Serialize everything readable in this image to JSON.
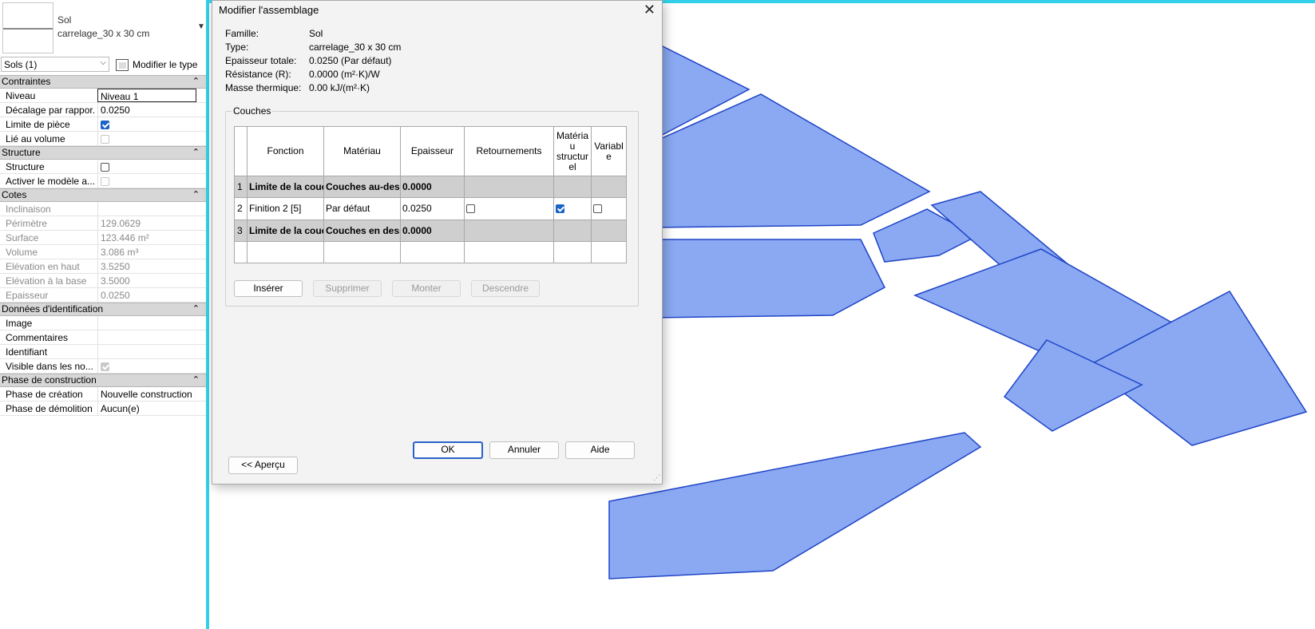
{
  "properties": {
    "type_family": "Sol",
    "type_name": "carrelage_30 x 30 cm",
    "filter": "Sols (1)",
    "edit_type_label": "Modifier le type",
    "groups": [
      {
        "title": "Contraintes",
        "rows": [
          {
            "label": "Niveau",
            "value": "Niveau 1",
            "kind": "edit"
          },
          {
            "label": "Décalage par rappor...",
            "value": "0.0250",
            "kind": "text"
          },
          {
            "label": "Limite de pièce",
            "value": "",
            "kind": "check-on"
          },
          {
            "label": "Lié au volume",
            "value": "",
            "kind": "check-dis"
          }
        ]
      },
      {
        "title": "Structure",
        "rows": [
          {
            "label": "Structure",
            "value": "",
            "kind": "check-off"
          },
          {
            "label": "Activer le modèle a...",
            "value": "",
            "kind": "check-dis"
          }
        ]
      },
      {
        "title": "Cotes",
        "rows": [
          {
            "label": "Inclinaison",
            "value": "",
            "kind": "dim"
          },
          {
            "label": "Périmètre",
            "value": "129.0629",
            "kind": "dim"
          },
          {
            "label": "Surface",
            "value": "123.446 m²",
            "kind": "dim"
          },
          {
            "label": "Volume",
            "value": "3.086 m³",
            "kind": "dim"
          },
          {
            "label": "Elévation en haut",
            "value": "3.5250",
            "kind": "dim"
          },
          {
            "label": "Elévation à la base",
            "value": "3.5000",
            "kind": "dim"
          },
          {
            "label": "Epaisseur",
            "value": "0.0250",
            "kind": "dim"
          }
        ]
      },
      {
        "title": "Données d'identification",
        "rows": [
          {
            "label": "Image",
            "value": "",
            "kind": "text"
          },
          {
            "label": "Commentaires",
            "value": "",
            "kind": "text"
          },
          {
            "label": "Identifiant",
            "value": "",
            "kind": "text"
          },
          {
            "label": "Visible dans les no...",
            "value": "",
            "kind": "check-dison"
          }
        ]
      },
      {
        "title": "Phase de construction",
        "rows": [
          {
            "label": "Phase de création",
            "value": "Nouvelle construction",
            "kind": "text"
          },
          {
            "label": "Phase de démolition",
            "value": "Aucun(e)",
            "kind": "text"
          }
        ]
      }
    ]
  },
  "dialog": {
    "title": "Modifier l'assemblage",
    "info": [
      {
        "key": "Famille:",
        "value": "Sol"
      },
      {
        "key": "Type:",
        "value": "carrelage_30 x 30 cm"
      },
      {
        "key": "Epaisseur totale:",
        "value": "0.0250 (Par défaut)"
      },
      {
        "key": "Résistance (R):",
        "value": "0.0000 (m²·K)/W"
      },
      {
        "key": "Masse thermique:",
        "value": "0.00 kJ/(m²·K)"
      }
    ],
    "couches_label": "Couches",
    "columns": [
      "Fonction",
      "Matériau",
      "Epaisseur",
      "Retournements",
      "Matériau structurel",
      "Variable"
    ],
    "column_lines": {
      "materiau_structurel": [
        "Matéria",
        "u",
        "structur",
        "el"
      ],
      "variable": [
        "Variabl",
        "e"
      ]
    },
    "layers": [
      {
        "num": "1",
        "fonction": "Limite de la couc",
        "materiau": "Couches au-dess",
        "epaisseur": "0.0000",
        "boundary": true
      },
      {
        "num": "2",
        "fonction": "Finition 2 [5]",
        "materiau": "Par défaut",
        "epaisseur": "0.0250",
        "boundary": false,
        "retournements": false,
        "structurel": true,
        "variable": false
      },
      {
        "num": "3",
        "fonction": "Limite de la couc",
        "materiau": "Couches en dess",
        "epaisseur": "0.0000",
        "boundary": true
      }
    ],
    "buttons": {
      "inserer": "Insérer",
      "supprimer": "Supprimer",
      "monter": "Monter",
      "descendre": "Descendre",
      "ok": "OK",
      "annuler": "Annuler",
      "aide": "Aide",
      "apercu": "<< Aperçu"
    }
  },
  "colors": {
    "floor_fill": "#8aa9f2",
    "floor_edge": "#1f44c7",
    "canvas_border": "#31d0e8",
    "accent": "#1b63c6"
  }
}
